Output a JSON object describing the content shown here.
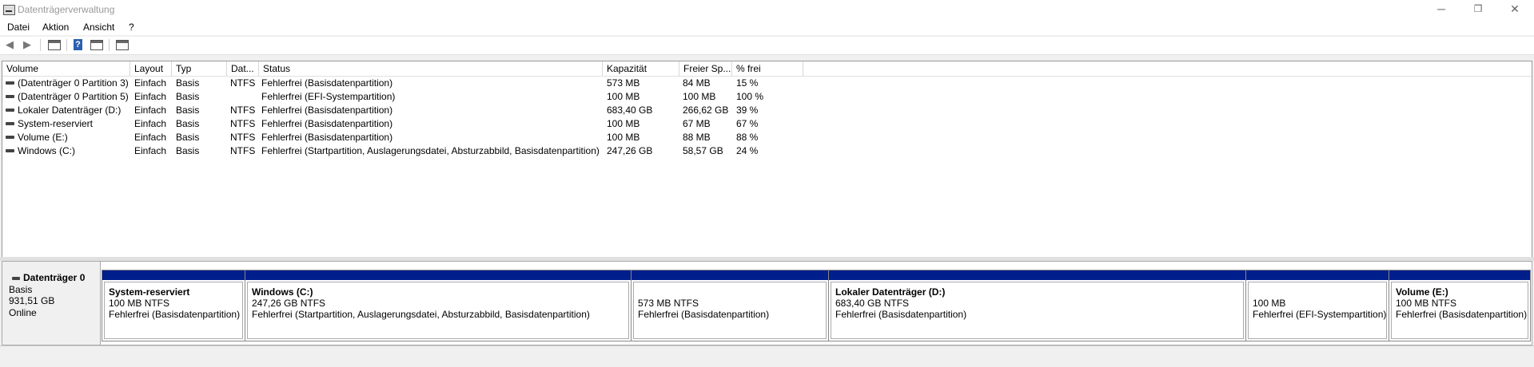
{
  "window": {
    "title": "Datenträgerverwaltung",
    "controls": {
      "minimize": "─",
      "restore": "❐",
      "close": "✕"
    }
  },
  "menu": [
    "Datei",
    "Aktion",
    "Ansicht",
    "?"
  ],
  "toolbar": {
    "back_icon": "back-arrow-icon",
    "forward_icon": "forward-arrow-icon",
    "help_label": "?"
  },
  "volume_list": {
    "columns": [
      "Volume",
      "Layout",
      "Typ",
      "Dat...",
      "Status",
      "Kapazität",
      "Freier Sp...",
      "% frei"
    ],
    "rows": [
      [
        "(Datenträger 0 Partition 3)",
        "Einfach",
        "Basis",
        "NTFS",
        "Fehlerfrei (Basisdatenpartition)",
        "573 MB",
        "84 MB",
        "15 %"
      ],
      [
        "(Datenträger 0 Partition 5)",
        "Einfach",
        "Basis",
        "",
        "Fehlerfrei (EFI-Systempartition)",
        "100 MB",
        "100 MB",
        "100 %"
      ],
      [
        "Lokaler Datenträger (D:)",
        "Einfach",
        "Basis",
        "NTFS",
        "Fehlerfrei (Basisdatenpartition)",
        "683,40 GB",
        "266,62 GB",
        "39 %"
      ],
      [
        "System-reserviert",
        "Einfach",
        "Basis",
        "NTFS",
        "Fehlerfrei (Basisdatenpartition)",
        "100 MB",
        "67 MB",
        "67 %"
      ],
      [
        "Volume (E:)",
        "Einfach",
        "Basis",
        "NTFS",
        "Fehlerfrei (Basisdatenpartition)",
        "100 MB",
        "88 MB",
        "88 %"
      ],
      [
        "Windows (C:)",
        "Einfach",
        "Basis",
        "NTFS",
        "Fehlerfrei (Startpartition, Auslagerungsdatei, Absturzabbild, Basisdatenpartition)",
        "247,26 GB",
        "58,57 GB",
        "24 %"
      ]
    ]
  },
  "disk": {
    "name": "Datenträger 0",
    "type": "Basis",
    "size": "931,51 GB",
    "state": "Online",
    "partitions": [
      {
        "name": "System-reserviert",
        "size": "100 MB NTFS",
        "status": "Fehlerfrei (Basisdatenpartition)"
      },
      {
        "name": "Windows  (C:)",
        "size": "247,26 GB NTFS",
        "status": "Fehlerfrei (Startpartition, Auslagerungsdatei, Absturzabbild, Basisdatenpartition)"
      },
      {
        "name": "",
        "size": "573 MB NTFS",
        "status": "Fehlerfrei (Basisdatenpartition)"
      },
      {
        "name": "Lokaler Datenträger  (D:)",
        "size": "683,40 GB NTFS",
        "status": "Fehlerfrei (Basisdatenpartition)"
      },
      {
        "name": "",
        "size": "100 MB",
        "status": "Fehlerfrei (EFI-Systempartition)"
      },
      {
        "name": "Volume  (E:)",
        "size": "100 MB NTFS",
        "status": "Fehlerfrei (Basisdatenpartition)"
      }
    ]
  },
  "colors": {
    "partition_bar": "#001e8c",
    "title_text": "#999999"
  }
}
